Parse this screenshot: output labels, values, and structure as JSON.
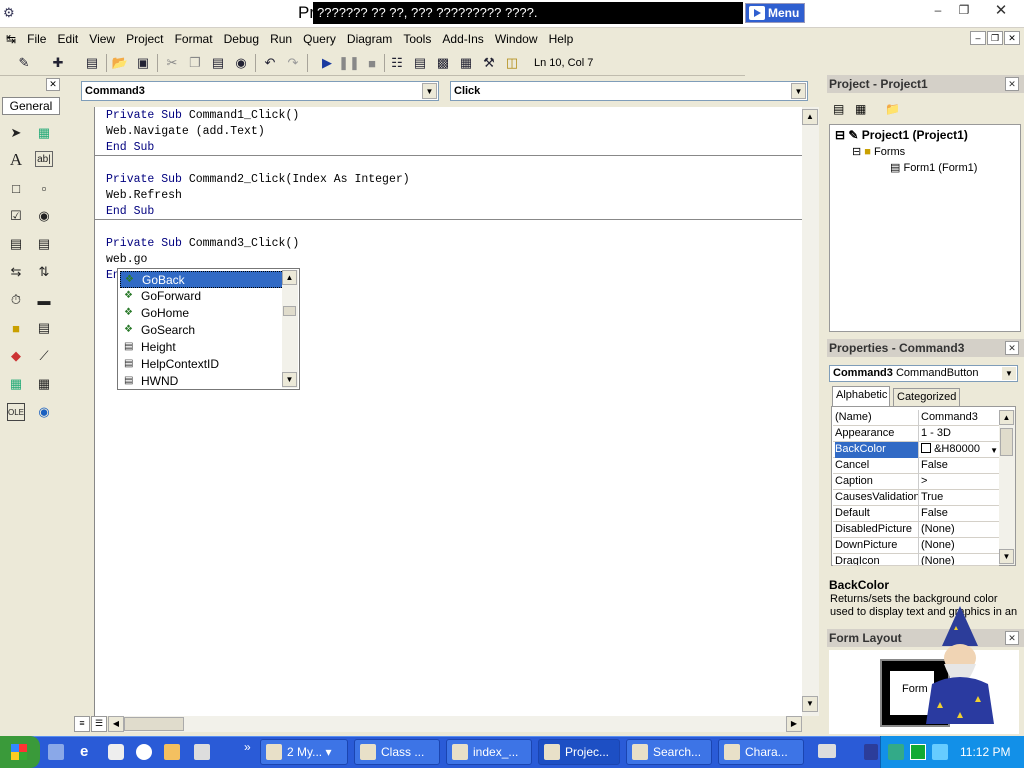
{
  "window": {
    "title": "Pr",
    "banner_text": "??????? ?? ??, ??? ????????? ????.",
    "banner_button": "Menu"
  },
  "menu": [
    "File",
    "Edit",
    "View",
    "Project",
    "Format",
    "Debug",
    "Run",
    "Query",
    "Diagram",
    "Tools",
    "Add-Ins",
    "Window",
    "Help"
  ],
  "toolbar": {
    "position": "Ln 10, Col 7"
  },
  "toolbox": {
    "tab": "General"
  },
  "editor": {
    "object_combo": "Command3",
    "proc_combo": "Click",
    "lines": [
      {
        "kw": "Private Sub ",
        "text": "Command1_Click()"
      },
      {
        "kw": "",
        "text": "Web.Navigate (add.Text)"
      },
      {
        "kw": "End Sub",
        "text": ""
      },
      {
        "kw": "Private Sub ",
        "text": "Command2_Click(Index As Integer)"
      },
      {
        "kw": "",
        "text": "Web.Refresh"
      },
      {
        "kw": "End Sub",
        "text": ""
      },
      {
        "kw": "Private Sub ",
        "text": "Command3_Click()"
      },
      {
        "kw": "",
        "text": "web.go"
      },
      {
        "kw": "",
        "text": "En"
      }
    ]
  },
  "autocomplete": {
    "items": [
      {
        "label": "GoBack",
        "kind": "method",
        "selected": true
      },
      {
        "label": "GoForward",
        "kind": "method"
      },
      {
        "label": "GoHome",
        "kind": "method"
      },
      {
        "label": "GoSearch",
        "kind": "method"
      },
      {
        "label": "Height",
        "kind": "property"
      },
      {
        "label": "HelpContextID",
        "kind": "property"
      },
      {
        "label": "HWND",
        "kind": "property"
      }
    ]
  },
  "project": {
    "title": "Project - Project1",
    "root": "Project1 (Project1)",
    "folder": "Forms",
    "form": "Form1 (Form1)"
  },
  "properties": {
    "title": "Properties - Command3",
    "object": "Command3",
    "object_type": "CommandButton",
    "tab_alpha": "Alphabetic",
    "tab_cat": "Categorized",
    "rows": [
      {
        "name": "(Name)",
        "value": "Command3"
      },
      {
        "name": "Appearance",
        "value": "1 - 3D"
      },
      {
        "name": "BackColor",
        "value": "&H80000",
        "selected": true
      },
      {
        "name": "Cancel",
        "value": "False"
      },
      {
        "name": "Caption",
        "value": ">"
      },
      {
        "name": "CausesValidation",
        "value": "True"
      },
      {
        "name": "Default",
        "value": "False"
      },
      {
        "name": "DisabledPicture",
        "value": "(None)"
      },
      {
        "name": "DownPicture",
        "value": "(None)"
      },
      {
        "name": "DragIcon",
        "value": "(None)"
      }
    ],
    "desc_title": "BackColor",
    "desc_text": "Returns/sets the background color used to display text and graphics in an"
  },
  "form_layout": {
    "title": "Form Layout",
    "form_label": "Form"
  },
  "taskbar": {
    "items": [
      {
        "label": "2 My...",
        "active": false
      },
      {
        "label": "Class ...",
        "active": false
      },
      {
        "label": "index_...",
        "active": false
      },
      {
        "label": "Projec...",
        "active": true
      },
      {
        "label": "Search...",
        "active": false
      },
      {
        "label": "Chara...",
        "active": false
      }
    ],
    "clock": "11:12 PM"
  }
}
